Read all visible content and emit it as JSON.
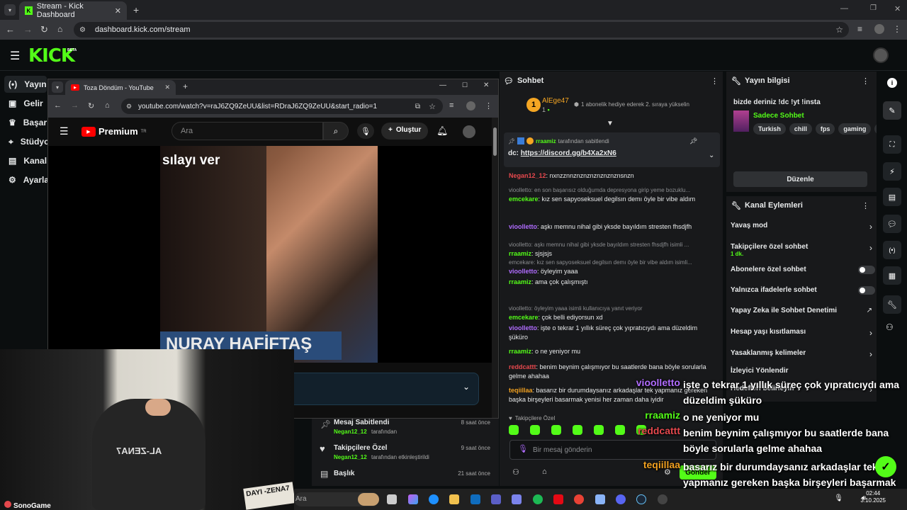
{
  "browser": {
    "tab_title": "Stream - Kick Dashboard",
    "url": "dashboard.kick.com/stream"
  },
  "kick": {
    "logo": "KICK",
    "beta": "BETA",
    "nav": [
      {
        "icon": "broadcast-icon",
        "label": "Yayın"
      },
      {
        "icon": "dollar-icon",
        "label": "Gelir"
      },
      {
        "icon": "trophy-icon",
        "label": "Başarı"
      },
      {
        "icon": "studio-icon",
        "label": "Stüdyo"
      },
      {
        "icon": "channel-icon",
        "label": "Kanal"
      },
      {
        "icon": "gear-icon",
        "label": "Ayarla"
      }
    ]
  },
  "youtube": {
    "tab_title": "Toza Döndüm - YouTube",
    "url": "youtube.com/watch?v=raJ6ZQ9ZeUU&list=RDraJ6ZQ9ZeUU&start_radio=1",
    "brand": "Premium",
    "brand_sup": "TR",
    "search_placeholder": "Ara",
    "create_label": "Oluştur",
    "cover_top": "sılayı ver",
    "cover_bottom": "NURAY HAFİFTAŞ"
  },
  "activity": [
    {
      "title": "Mesaj Sabitlendi",
      "user": "Negan12_12",
      "sub": "tarafından",
      "time": "8 saat önce"
    },
    {
      "title": "Takipçilere Özel",
      "user": "Negan12_12",
      "sub": "tarafından etkinleştirildi",
      "time": "9 saat önce"
    },
    {
      "title": "Başlık",
      "user": "",
      "sub": "",
      "time": "21 saat önce"
    }
  ],
  "chat": {
    "title": "Sohbet",
    "top_user": "AlEge47",
    "top_rank": "1",
    "top_count": "1",
    "sub_gift_text": "1 abonelik hediye ederek 2. sıraya yükselin",
    "pinned_by_user": "rraamiz",
    "pinned_by_text": "tarafından sabitlendi",
    "pinned_prefix": "dc: ",
    "pinned_link": "https://discord.gg/b4Xa2xN6",
    "messages": [
      {
        "reply": "",
        "user": "Negan12_12",
        "color": "#e5484d",
        "text": ": nxnzznnznznznznznznznsnzn"
      },
      {
        "reply": "vioolletto: en son başarısız olduğumda depresyona girip yeme bozuklu...",
        "user": "emcekare",
        "color": "#53fc18",
        "text": ": kız sen sapyoseksuel degilsın demı öyle bir vibe aldım"
      },
      {
        "reply": "",
        "user": "vioolletto",
        "color": "#b06cff",
        "text": ": aşkı memnu nihal gibi yksde bayıldım stresten fhsdjfh"
      },
      {
        "reply": "vioolletto: aşkı memnu nihal gibi yksde bayıldım stresten fhsdjfh isimli ...",
        "user": "rraamiz",
        "color": "#53fc18",
        "text": ": sjsjsjs"
      },
      {
        "reply": "emcekare: kız sen sapyoseksuel degilsın demı öyle bir vibe aldım isimli...",
        "user": "vioolletto",
        "color": "#b06cff",
        "text": ": öyleyim yaaa"
      },
      {
        "reply": "",
        "user": "rraamiz",
        "color": "#53fc18",
        "text": ": ama çok çalışmıştı"
      },
      {
        "reply": "vioolletto: öyleyim yaaa isimli kullanıcıya yanıt veriyor",
        "user": "emcekare",
        "color": "#53fc18",
        "text": ": çok belli ediyorsun xd"
      },
      {
        "reply": "",
        "user": "vioolletto",
        "color": "#b06cff",
        "text": ": işte o tekrar 1 yıllık süreç çok yıpratıcıydı ama düzeldim şüküro"
      },
      {
        "reply": "",
        "user": "rraamiz",
        "color": "#53fc18",
        "text": ": o ne yeniyor mu"
      },
      {
        "reply": "",
        "user": "reddcattt",
        "color": "#e5484d",
        "text": ": benim beynim çalışmıyor bu saatlerde bana böyle sorularla gelme ahahaa"
      },
      {
        "reply": "",
        "user": "teqiillaa",
        "color": "#f0a020",
        "text": ": basarız bir durumdaysanız arkadaşlar tek yapmanız gereken başka birşeyleri basarmak yenisi her zaman daha iyidir"
      }
    ],
    "followers_only": "Takipçilere Özel",
    "input_placeholder": "Bir mesaj gönderin",
    "send_label": "Gönder"
  },
  "stream_info": {
    "title": "Yayın bilgisi",
    "stream_title": "bizde deriniz !dc !yt !insta",
    "category": "Sadece Sohbet",
    "tags": [
      "Turkish",
      "chill",
      "fps",
      "gaming",
      "fu"
    ],
    "edit_label": "Düzenle"
  },
  "channel_actions": {
    "title": "Kanal Eylemleri",
    "items": [
      {
        "label": "Yavaş mod",
        "sub": "",
        "control": "chevron"
      },
      {
        "label": "Takipçilere özel sohbet",
        "sub": "1 dk.",
        "control": "chevron"
      },
      {
        "label": "Abonelere özel sohbet",
        "sub": "",
        "control": "toggle"
      },
      {
        "label": "Yalnızca ifadelerle sohbet",
        "sub": "",
        "control": "toggle"
      },
      {
        "label": "Yapay Zeka ile Sohbet Denetimi",
        "sub": "",
        "control": "external"
      },
      {
        "label": "Hesap yaşı kısıtlaması",
        "sub": "",
        "control": "chevron"
      },
      {
        "label": "Yasaklanmış kelimeler",
        "sub": "",
        "control": "chevron"
      },
      {
        "label": "İzleyici Yönlendir",
        "sub": "",
        "control": "none"
      },
      {
        "label": "Hedefleri belirleyin",
        "sub": "",
        "control": "chevron"
      }
    ]
  },
  "overlay": [
    {
      "user": "vioolletto",
      "color": "#b06cff",
      "text": "işte o tekrar 1 yıllık süreç çok yıpratıcıydı ama düzeldim şüküro"
    },
    {
      "user": "rraamiz",
      "color": "#53fc18",
      "text": "o ne yeniyor mu"
    },
    {
      "user": "reddcattt",
      "color": "#e5484d",
      "text": "benim beynim çalışmıyor bu saatlerde bana böyle sorularla gelme ahahaa"
    },
    {
      "user": "teqiillaa",
      "color": "#f0a020",
      "text": "basarız bir durumdaysanız arkadaşlar tek yapmanız gereken başka birşeyleri başarmak yenisi her zaman daha iyidir"
    }
  ],
  "webcam": {
    "chair_text": "AL-ZENA7",
    "sign_text": "DAYI -ZENA7",
    "watermark": "SonoGame"
  },
  "taskbar": {
    "search_placeholder": "Ara",
    "time": "02:44",
    "date": "3.10.2025"
  }
}
